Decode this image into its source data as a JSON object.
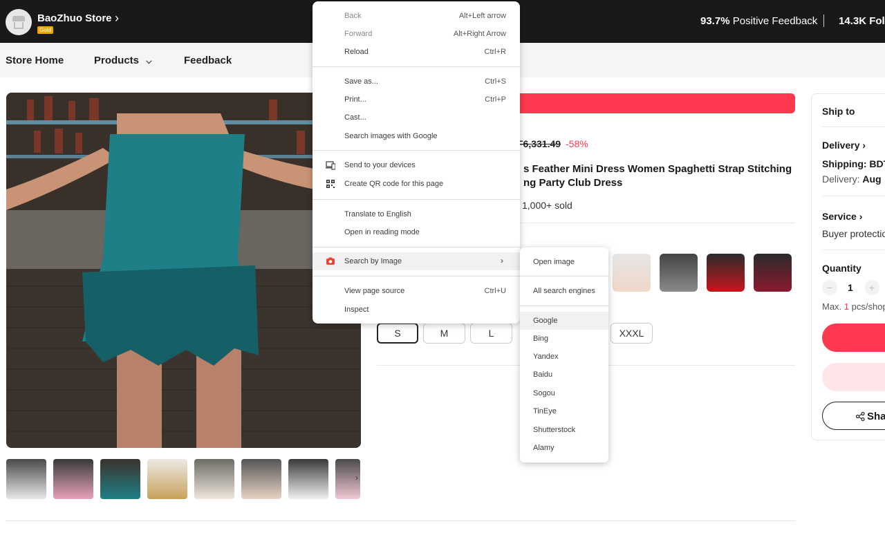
{
  "store": {
    "name": "BaoZhuo Store",
    "badge": "Gold",
    "feedback_value": "93.7%",
    "feedback_label": "Positive Feedback",
    "followers": "14.3K Follo"
  },
  "nav": {
    "home": "Store Home",
    "products": "Products",
    "feedback": "Feedback"
  },
  "product": {
    "original_price": "F6,331.49",
    "discount": "-58%",
    "title_line1": "s Feather Mini Dress Women Spaghetti Strap Stitching",
    "title_line2": "ng Party Club Dress",
    "sold": "1,000+ sold",
    "sizes": [
      "S",
      "M",
      "L",
      "XXXL"
    ],
    "selected_size": "S"
  },
  "side_panel": {
    "ship_to": "Ship to",
    "delivery": "Delivery",
    "shipping": "Shipping: BDT",
    "delivery_label": "Delivery:",
    "delivery_date": "Aug",
    "service": "Service",
    "buyer_protection": "Buyer protectio",
    "quantity": "Quantity",
    "qty_value": "1",
    "max_prefix": "Max.",
    "max_value": "1",
    "max_suffix": "pcs/shop",
    "share": "Sha"
  },
  "context_menu": {
    "back": "Back",
    "back_shortcut": "Alt+Left arrow",
    "forward": "Forward",
    "forward_shortcut": "Alt+Right Arrow",
    "reload": "Reload",
    "reload_shortcut": "Ctrl+R",
    "save_as": "Save as...",
    "save_as_shortcut": "Ctrl+S",
    "print": "Print...",
    "print_shortcut": "Ctrl+P",
    "cast": "Cast...",
    "search_images_google": "Search images with Google",
    "send_to_devices": "Send to your devices",
    "create_qr": "Create QR code for this page",
    "translate": "Translate to English",
    "reading_mode": "Open in reading mode",
    "search_by_image": "Search by Image",
    "view_source": "View page source",
    "view_source_shortcut": "Ctrl+U",
    "inspect": "Inspect"
  },
  "sub_menu": {
    "open_image": "Open image",
    "all_engines": "All search engines",
    "engines": [
      "Google",
      "Bing",
      "Yandex",
      "Baidu",
      "Sogou",
      "TinEye",
      "Shutterstock",
      "Alamy"
    ]
  },
  "colors": {
    "accent": "#fd384f",
    "topbar": "#191919",
    "gold": "#f0a500"
  }
}
